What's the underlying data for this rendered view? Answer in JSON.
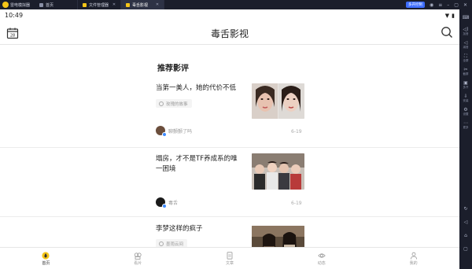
{
  "emulator": {
    "app_name": "雷电模拟器",
    "tabs": [
      {
        "label": "首页",
        "active": false
      },
      {
        "label": "文件管理器",
        "active": false
      },
      {
        "label": "毒舌影视",
        "active": true
      }
    ],
    "account_badge": "多开控制",
    "sidebar": [
      {
        "icon": "keyboard-icon",
        "glyph": "⌨",
        "label": ""
      },
      {
        "icon": "volume-up-icon",
        "glyph": "◁)",
        "label": "加音"
      },
      {
        "icon": "volume-down-icon",
        "glyph": "◁",
        "label": "减音"
      },
      {
        "icon": "fullscreen-icon",
        "glyph": "⛶",
        "label": "全屏"
      },
      {
        "icon": "scissors-icon",
        "glyph": "✂",
        "label": "截屏"
      },
      {
        "icon": "multi-open-icon",
        "glyph": "▣",
        "label": "多开"
      },
      {
        "icon": "install-icon",
        "glyph": "⇩",
        "label": "安装"
      },
      {
        "icon": "settings-icon",
        "glyph": "⚙",
        "label": "设置"
      },
      {
        "icon": "more-icon",
        "glyph": "⋯",
        "label": "更多"
      },
      {
        "icon": "rotate-icon",
        "glyph": "↻",
        "label": ""
      },
      {
        "icon": "back-icon",
        "glyph": "◁",
        "label": ""
      },
      {
        "icon": "home-icon",
        "glyph": "⌂",
        "label": ""
      },
      {
        "icon": "recent-icon",
        "glyph": "▢",
        "label": ""
      }
    ]
  },
  "status": {
    "time": "10:49",
    "wifi": "▼",
    "battery": "▮"
  },
  "app": {
    "title": "毒舌影视",
    "section_title": "推荐影评",
    "articles": [
      {
        "title": "当第一美人，她的代价不低",
        "tag": "玫瑰的故事",
        "author": "聊颤颤了吗",
        "date": "6-19"
      },
      {
        "title": "塌房，才不是TF养成系的唯一困境",
        "tag": "",
        "author": "毒舌",
        "date": "6-19"
      },
      {
        "title": "李梦这样的疯子",
        "tag": "墨雨云间",
        "author": "",
        "date": ""
      }
    ],
    "bottom_nav": [
      {
        "label": "首页",
        "icon": "home-flame-icon",
        "active": true
      },
      {
        "label": "看片",
        "icon": "film-icon",
        "active": false
      },
      {
        "label": "文章",
        "icon": "document-icon",
        "active": false
      },
      {
        "label": "动态",
        "icon": "eye-icon",
        "active": false
      },
      {
        "label": "我的",
        "icon": "user-icon",
        "active": false
      }
    ]
  },
  "colors": {
    "accent": "#f5c518",
    "emulator_bg": "#1b1e2b",
    "verified": "#3d8bff"
  }
}
